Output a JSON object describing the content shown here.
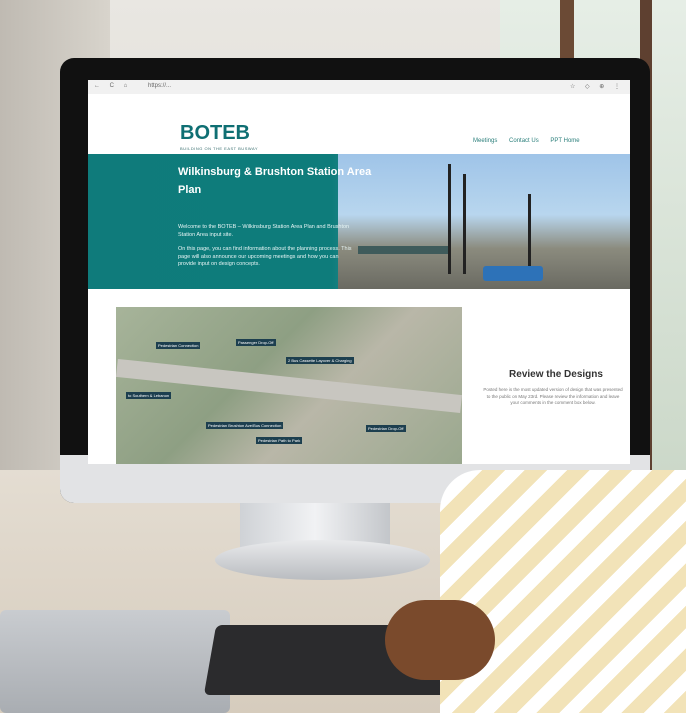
{
  "browser": {
    "nav_icons": "← C ⌂",
    "url": "https://...",
    "extension_icons": "☆ ◇ ⊕ ⋮"
  },
  "site": {
    "logo": "BOTEB",
    "logo_tagline": "BUILDING ON THE EAST BUSWAY",
    "nav": [
      "Meetings",
      "Contact Us",
      "PPT Home"
    ]
  },
  "hero": {
    "title": "Wilkinsburg & Brushton Station Area Plan",
    "paragraph1": "Welcome to the BOTEB – Wilkinsburg Station Area Plan and Brushton Station Area input site.",
    "paragraph2": "On this page, you can find information about the planning process. This page will also announce our upcoming meetings and how you can provide input on design concepts."
  },
  "map": {
    "tags": [
      "Pedestrian Connection",
      "Passenger Drop-Off",
      "2 Bus Cassette Layover & Charging",
      "to Southern & Lebanon",
      "Pedestrian Brushton Ave/Bus Connection",
      "Pedestrian Path to Park",
      "Pedestrian Drop-Off"
    ]
  },
  "review": {
    "title": "Review the Designs",
    "text": "Posted here is the most updated version of design that was presented to the public on May 23rd. Please review the information and leave your comments in the comment box below."
  }
}
